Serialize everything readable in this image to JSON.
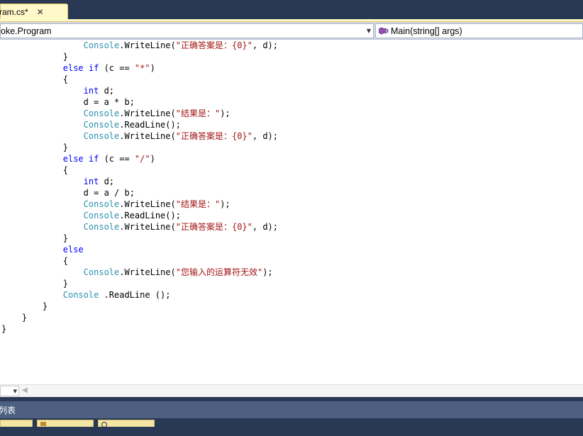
{
  "tab": {
    "label": "ram.cs*",
    "close": "✕"
  },
  "nav": {
    "left": "oke.Program",
    "right": "Main(string[] args)"
  },
  "code": [
    {
      "indent": 16,
      "tokens": [
        [
          "ty",
          "Console"
        ],
        [
          "p",
          "."
        ],
        [
          "p",
          "WriteLine"
        ],
        [
          "p",
          "("
        ],
        [
          "str",
          "\"正确答案是：{0}\""
        ],
        [
          "p",
          ", d);"
        ]
      ]
    },
    {
      "indent": 12,
      "tokens": [
        [
          "p",
          "}"
        ]
      ]
    },
    {
      "indent": 12,
      "tokens": [
        [
          "kw",
          "else"
        ],
        [
          "p",
          " "
        ],
        [
          "kw",
          "if"
        ],
        [
          "p",
          " (c == "
        ],
        [
          "str",
          "\"*\""
        ],
        [
          "p",
          ")"
        ]
      ]
    },
    {
      "indent": 12,
      "tokens": [
        [
          "p",
          "{"
        ]
      ]
    },
    {
      "indent": 16,
      "tokens": [
        [
          "kw",
          "int"
        ],
        [
          "p",
          " d;"
        ]
      ]
    },
    {
      "indent": 16,
      "tokens": [
        [
          "p",
          "d = a * b;"
        ]
      ]
    },
    {
      "indent": 16,
      "tokens": [
        [
          "ty",
          "Console"
        ],
        [
          "p",
          "."
        ],
        [
          "p",
          "WriteLine"
        ],
        [
          "p",
          "("
        ],
        [
          "str",
          "\"结果是：\""
        ],
        [
          "p",
          ");"
        ]
      ]
    },
    {
      "indent": 16,
      "tokens": [
        [
          "ty",
          "Console"
        ],
        [
          "p",
          "."
        ],
        [
          "p",
          "ReadLine"
        ],
        [
          "p",
          "();"
        ]
      ]
    },
    {
      "indent": 16,
      "tokens": [
        [
          "ty",
          "Console"
        ],
        [
          "p",
          "."
        ],
        [
          "p",
          "WriteLine"
        ],
        [
          "p",
          "("
        ],
        [
          "str",
          "\"正确答案是：{0}\""
        ],
        [
          "p",
          ", d);"
        ]
      ]
    },
    {
      "indent": 12,
      "tokens": [
        [
          "p",
          "}"
        ]
      ]
    },
    {
      "indent": 12,
      "tokens": [
        [
          "kw",
          "else"
        ],
        [
          "p",
          " "
        ],
        [
          "kw",
          "if"
        ],
        [
          "p",
          " (c == "
        ],
        [
          "str",
          "\"/\""
        ],
        [
          "p",
          ")"
        ]
      ]
    },
    {
      "indent": 12,
      "tokens": [
        [
          "p",
          "{"
        ]
      ]
    },
    {
      "indent": 16,
      "tokens": [
        [
          "kw",
          "int"
        ],
        [
          "p",
          " d;"
        ]
      ]
    },
    {
      "indent": 16,
      "tokens": [
        [
          "p",
          "d = a / b;"
        ]
      ]
    },
    {
      "indent": 16,
      "tokens": [
        [
          "ty",
          "Console"
        ],
        [
          "p",
          "."
        ],
        [
          "p",
          "WriteLine"
        ],
        [
          "p",
          "("
        ],
        [
          "str",
          "\"结果是：\""
        ],
        [
          "p",
          ");"
        ]
      ]
    },
    {
      "indent": 16,
      "tokens": [
        [
          "ty",
          "Console"
        ],
        [
          "p",
          "."
        ],
        [
          "p",
          "ReadLine"
        ],
        [
          "p",
          "();"
        ]
      ]
    },
    {
      "indent": 16,
      "tokens": [
        [
          "ty",
          "Console"
        ],
        [
          "p",
          "."
        ],
        [
          "p",
          "WriteLine"
        ],
        [
          "p",
          "("
        ],
        [
          "str",
          "\"正确答案是：{0}\""
        ],
        [
          "p",
          ", d);"
        ]
      ]
    },
    {
      "indent": 12,
      "tokens": [
        [
          "p",
          "}"
        ]
      ]
    },
    {
      "indent": 12,
      "tokens": [
        [
          "kw",
          "else"
        ]
      ]
    },
    {
      "indent": 12,
      "tokens": [
        [
          "p",
          "{"
        ]
      ]
    },
    {
      "indent": 16,
      "tokens": [
        [
          "ty",
          "Console"
        ],
        [
          "p",
          "."
        ],
        [
          "p",
          "WriteLine"
        ],
        [
          "p",
          "("
        ],
        [
          "str",
          "\"您输入的运算符无效\""
        ],
        [
          "p",
          ");"
        ]
      ]
    },
    {
      "indent": 12,
      "tokens": [
        [
          "p",
          "}"
        ]
      ]
    },
    {
      "indent": 12,
      "tokens": [
        [
          "ty",
          "Console"
        ],
        [
          "p",
          " .ReadLine ();"
        ]
      ]
    },
    {
      "indent": 8,
      "tokens": [
        [
          "p",
          "}"
        ]
      ]
    },
    {
      "indent": 4,
      "tokens": [
        [
          "p",
          "}"
        ]
      ]
    },
    {
      "indent": 0,
      "tokens": [
        [
          "p",
          "}"
        ]
      ]
    }
  ],
  "zoom": {
    "arrow": "▼"
  },
  "scroll": {
    "left_arrow": "◀"
  },
  "panel": {
    "title": "列表"
  },
  "colors": {
    "keyword": "#0000ff",
    "type": "#2b91af",
    "string": "#a31515",
    "tab_active": "#fff8c8",
    "chrome": "#293955"
  }
}
